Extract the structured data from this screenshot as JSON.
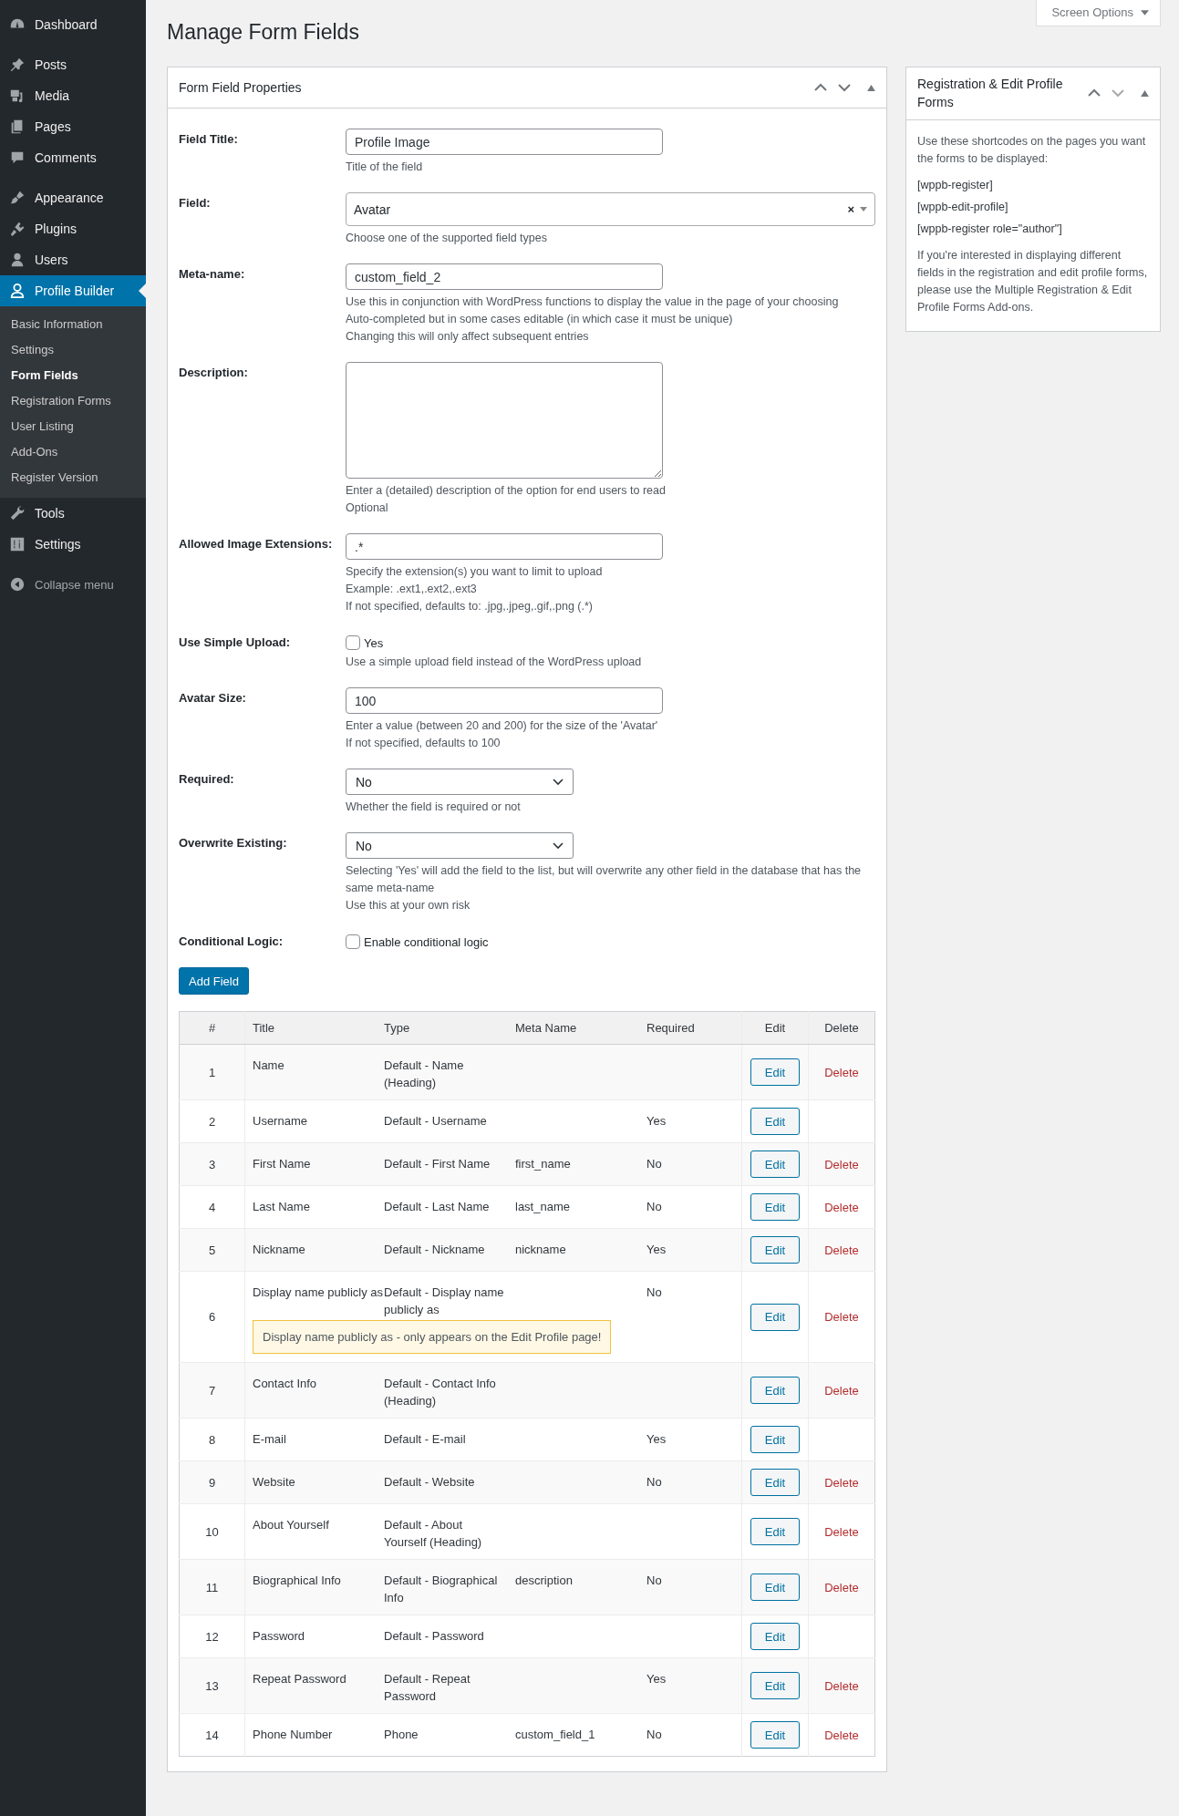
{
  "sidebar": {
    "groups": [
      {
        "items": [
          {
            "label": "Dashboard",
            "selected": false
          }
        ]
      },
      {
        "items": [
          {
            "label": "Posts",
            "selected": false
          },
          {
            "label": "Media",
            "selected": false
          },
          {
            "label": "Pages",
            "selected": false
          },
          {
            "label": "Comments",
            "selected": false
          }
        ]
      },
      {
        "items": [
          {
            "label": "Appearance",
            "selected": false
          },
          {
            "label": "Plugins",
            "selected": false
          },
          {
            "label": "Users",
            "selected": false
          },
          {
            "label": "Profile Builder",
            "selected": true,
            "submenu": [
              {
                "label": "Basic Information",
                "selected": false
              },
              {
                "label": "Settings",
                "selected": false
              },
              {
                "label": "Form Fields",
                "selected": true
              },
              {
                "label": "Registration Forms",
                "selected": false
              },
              {
                "label": "User Listing",
                "selected": false
              },
              {
                "label": "Add-Ons",
                "selected": false
              },
              {
                "label": "Register Version",
                "selected": false
              }
            ]
          },
          {
            "label": "Tools",
            "selected": false
          },
          {
            "label": "Settings",
            "selected": false
          }
        ]
      }
    ],
    "collapse_menu": "Collapse menu"
  },
  "screen_options": "Screen Options",
  "page_title": "Manage Form Fields",
  "form_panel": {
    "title": "Form Field Properties",
    "fields": [
      {
        "kind": "text",
        "label": "Field Title:",
        "value": "Profile Image",
        "help": [
          "Title of the field"
        ]
      },
      {
        "kind": "combo",
        "label": "Field:",
        "value": "Avatar",
        "clear": "×",
        "help": [
          "Choose one of the supported field types"
        ]
      },
      {
        "kind": "text",
        "label": "Meta-name:",
        "value": "custom_field_2",
        "help": [
          "Use this in conjunction with WordPress functions to display the value in the page of your choosing",
          "Auto-completed but in some cases editable (in which case it must be unique)",
          "Changing this will only affect subsequent entries"
        ]
      },
      {
        "kind": "textarea",
        "label": "Description:",
        "help": [
          "Enter a (detailed) description of the option for end users to read",
          "Optional"
        ]
      },
      {
        "kind": "text",
        "label": "Allowed Image Extensions:",
        "value": ".*",
        "help": [
          "Specify the extension(s) you want to limit to upload",
          "Example: .ext1,.ext2,.ext3",
          "If not specified, defaults to: .jpg,.jpeg,.gif,.png (.*)"
        ]
      },
      {
        "kind": "checkbox",
        "label": "Use Simple Upload:",
        "option": "Yes",
        "checked": false,
        "help": [
          "Use a simple upload field instead of the WordPress upload"
        ]
      },
      {
        "kind": "text",
        "label": "Avatar Size:",
        "value": "100",
        "help": [
          "Enter a value (between 20 and 200) for the size of the 'Avatar'",
          "If not specified, defaults to 100"
        ]
      },
      {
        "kind": "select",
        "label": "Required:",
        "value": "No",
        "help": [
          "Whether the field is required or not"
        ]
      },
      {
        "kind": "select",
        "label": "Overwrite Existing:",
        "value": "No",
        "help": [
          "Selecting 'Yes' will add the field to the list, but will overwrite any other field in the database that has the same meta-name",
          "Use this at your own risk"
        ]
      },
      {
        "kind": "checkbox",
        "label": "Conditional Logic:",
        "option": "Enable conditional logic",
        "checked": false
      }
    ],
    "add_button": "Add Field",
    "table": {
      "columns": [
        "#",
        "Title",
        "Type",
        "Meta Name",
        "Required",
        "Edit",
        "Delete"
      ],
      "rows": [
        {
          "number": "1",
          "title": "Name",
          "type": "Default - Name (Heading)",
          "edit": "Edit",
          "delete": "Delete"
        },
        {
          "number": "2",
          "title": "Username",
          "type": "Default - Username",
          "required": "Yes",
          "edit": "Edit"
        },
        {
          "number": "3",
          "title": "First Name",
          "type": "Default - First Name",
          "meta_name": "first_name",
          "required": "No",
          "edit": "Edit",
          "delete": "Delete"
        },
        {
          "number": "4",
          "title": "Last Name",
          "type": "Default - Last Name",
          "meta_name": "last_name",
          "required": "No",
          "edit": "Edit",
          "delete": "Delete"
        },
        {
          "number": "5",
          "title": "Nickname",
          "type": "Default - Nickname",
          "meta_name": "nickname",
          "required": "Yes",
          "edit": "Edit",
          "delete": "Delete"
        },
        {
          "number": "6",
          "title": "Display name publicly as",
          "type": "Default - Display name publicly as",
          "required": "No",
          "notice": "Display name publicly as - only appears on the Edit Profile page!",
          "edit": "Edit",
          "delete": "Delete"
        },
        {
          "number": "7",
          "title": "Contact Info",
          "type": "Default - Contact Info (Heading)",
          "edit": "Edit",
          "delete": "Delete"
        },
        {
          "number": "8",
          "title": "E-mail",
          "type": "Default - E-mail",
          "required": "Yes",
          "edit": "Edit"
        },
        {
          "number": "9",
          "title": "Website",
          "type": "Default - Website",
          "required": "No",
          "edit": "Edit",
          "delete": "Delete"
        },
        {
          "number": "10",
          "title": "About Yourself",
          "type": "Default - About Yourself (Heading)",
          "edit": "Edit",
          "delete": "Delete"
        },
        {
          "number": "11",
          "title": "Biographical Info",
          "type": "Default - Biographical Info",
          "meta_name": "description",
          "required": "No",
          "edit": "Edit",
          "delete": "Delete"
        },
        {
          "number": "12",
          "title": "Password",
          "type": "Default - Password",
          "edit": "Edit"
        },
        {
          "number": "13",
          "title": "Repeat Password",
          "type": "Default - Repeat Password",
          "required": "Yes",
          "edit": "Edit",
          "delete": "Delete"
        },
        {
          "number": "14",
          "title": "Phone Number",
          "type": "Phone",
          "meta_name": "custom_field_1",
          "required": "No",
          "edit": "Edit",
          "delete": "Delete"
        }
      ]
    }
  },
  "side_panel": {
    "title": "Registration & Edit Profile Forms",
    "intro": "Use these shortcodes on the pages you want the forms to be displayed:",
    "shortcodes": [
      "[wppb-register]",
      "[wppb-edit-profile]",
      "[wppb-register role=\"author\"]"
    ],
    "note": "If you're interested in displaying different fields in the registration and edit profile forms, please use the Multiple Registration & Edit Profile Forms Add-ons."
  }
}
